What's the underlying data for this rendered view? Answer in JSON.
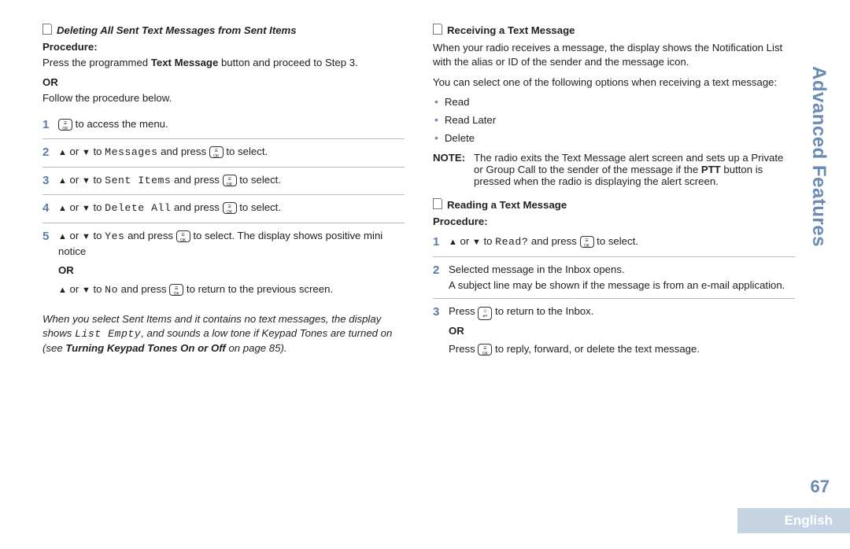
{
  "side_tab": "Advanced Features",
  "page_number": "67",
  "language": "English",
  "left": {
    "h1": "Deleting All Sent Text Messages from Sent Items",
    "procedure_label": "Procedure:",
    "intro_a": "Press the programmed ",
    "intro_bold": "Text Message",
    "intro_b": " button and proceed to Step 3.",
    "or": "OR",
    "intro2": "Follow the procedure below.",
    "step1_after": " to access the menu.",
    "nav_or": " or ",
    "to": " to ",
    "and_press": " and press ",
    "to_select": " to select.",
    "messages": "Messages",
    "sent_items": "Sent Items",
    "delete_all": "Delete All",
    "yes": "Yes",
    "no": "No",
    "step5_tail": " to select. The display shows positive mini notice",
    "step5_or": "OR",
    "step5_return": " to return to the previous screen.",
    "footnote_a": "When you select Sent Items and it contains no text messages, the display shows ",
    "footnote_mono": "List Empty",
    "footnote_b": ", and sounds a low tone if Keypad Tones are turned on (see ",
    "footnote_bold": "Turning Keypad Tones On or Off",
    "footnote_c": " on page 85)."
  },
  "right": {
    "h1": "Receiving a Text Message",
    "p1": "When your radio receives a message, the display shows the Notification List with the alias or ID of the sender and the message icon.",
    "p2": "You can select one of the following options when receiving a text message:",
    "opt1": "Read",
    "opt2": "Read Later",
    "opt3": "Delete",
    "note_label": "NOTE:",
    "note_a": "The radio exits the Text Message alert screen and sets up a Private or Group Call to the sender of the message if the ",
    "note_bold": "PTT",
    "note_b": " button is pressed when the radio is displaying the alert screen.",
    "h2": "Reading a Text Message",
    "procedure_label": "Procedure:",
    "read": "Read?",
    "step2": "Selected message in the Inbox opens.",
    "step2b": "A subject line may be shown if the message is from an e-mail application.",
    "step3_a": "Press ",
    "step3_b": " to return to the Inbox.",
    "step3_or": "OR",
    "step3_c": "Press ",
    "step3_d": " to reply, forward, or delete the text message."
  }
}
